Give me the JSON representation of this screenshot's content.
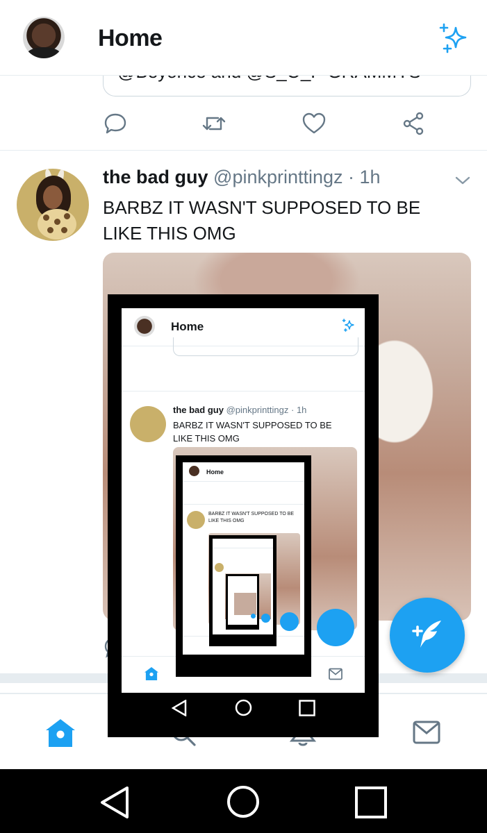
{
  "header": {
    "title": "Home",
    "avatar_icon": "user-avatar",
    "sparkle_icon": "sparkle-icon"
  },
  "prev_tweet": {
    "quote_text": "@Beyonce and @S_O_P GRAMMYS"
  },
  "tweet": {
    "name": "the bad guy",
    "handle": "@pinkprinttingz",
    "separator": " · ",
    "time": "1h",
    "text": "BARBZ IT WASN'T SUPPOSED TO BE LIKE THIS OMG"
  },
  "nested": {
    "title": "Home"
  },
  "colors": {
    "accent": "#1da1f2",
    "secondary_text": "#657786",
    "icon_gray": "#657786",
    "divider": "#e6ecf0"
  }
}
